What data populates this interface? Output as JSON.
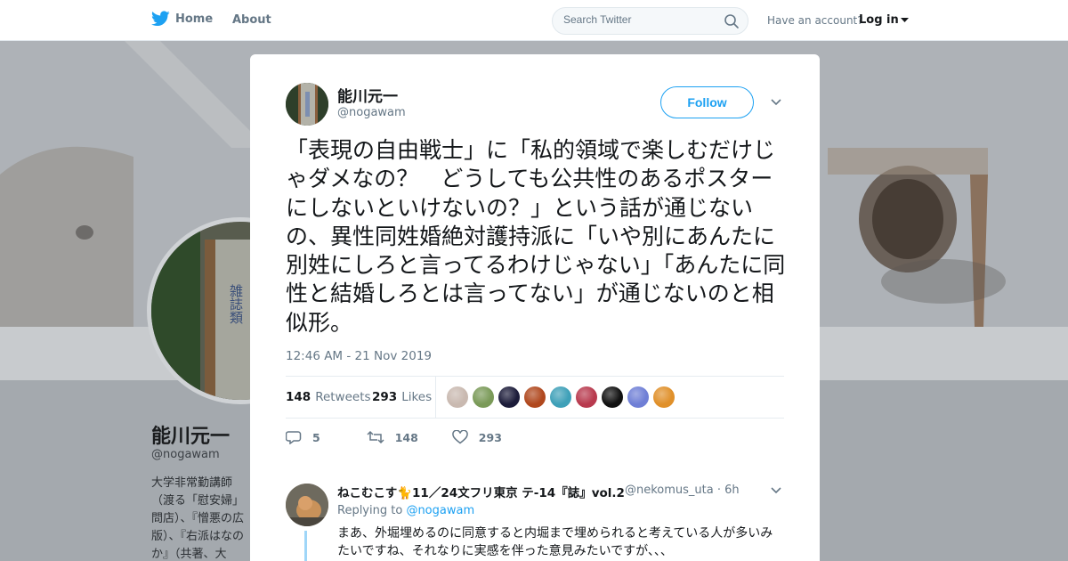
{
  "nav": {
    "home_label": "Home",
    "about_label": "About",
    "search_placeholder": "Search Twitter",
    "have_account": "Have an account?",
    "login_label": "Log in"
  },
  "background_profile": {
    "name": "能川元一",
    "handle": "@nogawam",
    "bio": "大学非常勤講師（渡る「慰安婦」問店）、『憎悪の広版）、『右派はなのか』（共著、大"
  },
  "tweet": {
    "author_name": "能川元一",
    "author_handle": "@nogawam",
    "follow_label": "Follow",
    "text": "「表現の自由戦士」に「私的領域で楽しむだけじゃダメなの？　どうしても公共性のあるポスターにしないといけないの？」という話が通じないの、異性同姓婚絶対護持派に「いや別にあんたに別姓にしろと言ってるわけじゃない」「あんたに同性と結婚しろとは言ってない」が通じないのと相似形。",
    "timestamp": "12:46 AM - 21 Nov 2019",
    "retweets_count": "148",
    "retweets_label": "Retweets",
    "likes_count": "293",
    "likes_label": "Likes",
    "actions": {
      "reply_count": "5",
      "retweet_count": "148",
      "like_count": "293"
    }
  },
  "likers": [
    {
      "color": "#c9b9b0"
    },
    {
      "color": "#7a9a58"
    },
    {
      "color": "#1c1c3a"
    },
    {
      "color": "#b0481e"
    },
    {
      "color": "#3ea0b8"
    },
    {
      "color": "#b83a4e"
    },
    {
      "color": "#111111"
    },
    {
      "color": "#6f7fd6"
    },
    {
      "color": "#e0902a"
    }
  ],
  "reply": {
    "author_name": "ねこむこす🐈11／24文フリ東京 テ-14『誌』vol.2",
    "author_handle": "@nekomus_uta · 6h",
    "replying_prefix": "Replying to",
    "replying_to": "@nogawam",
    "text": "まあ、外堀埋めるのに同意すると内堀まで埋められると考えている人が多いみたいですね、それなりに実感を伴った意見みたいですが、、、"
  },
  "colors": {
    "accent": "#1da1f2",
    "text": "#14171a",
    "secondary": "#657786"
  }
}
